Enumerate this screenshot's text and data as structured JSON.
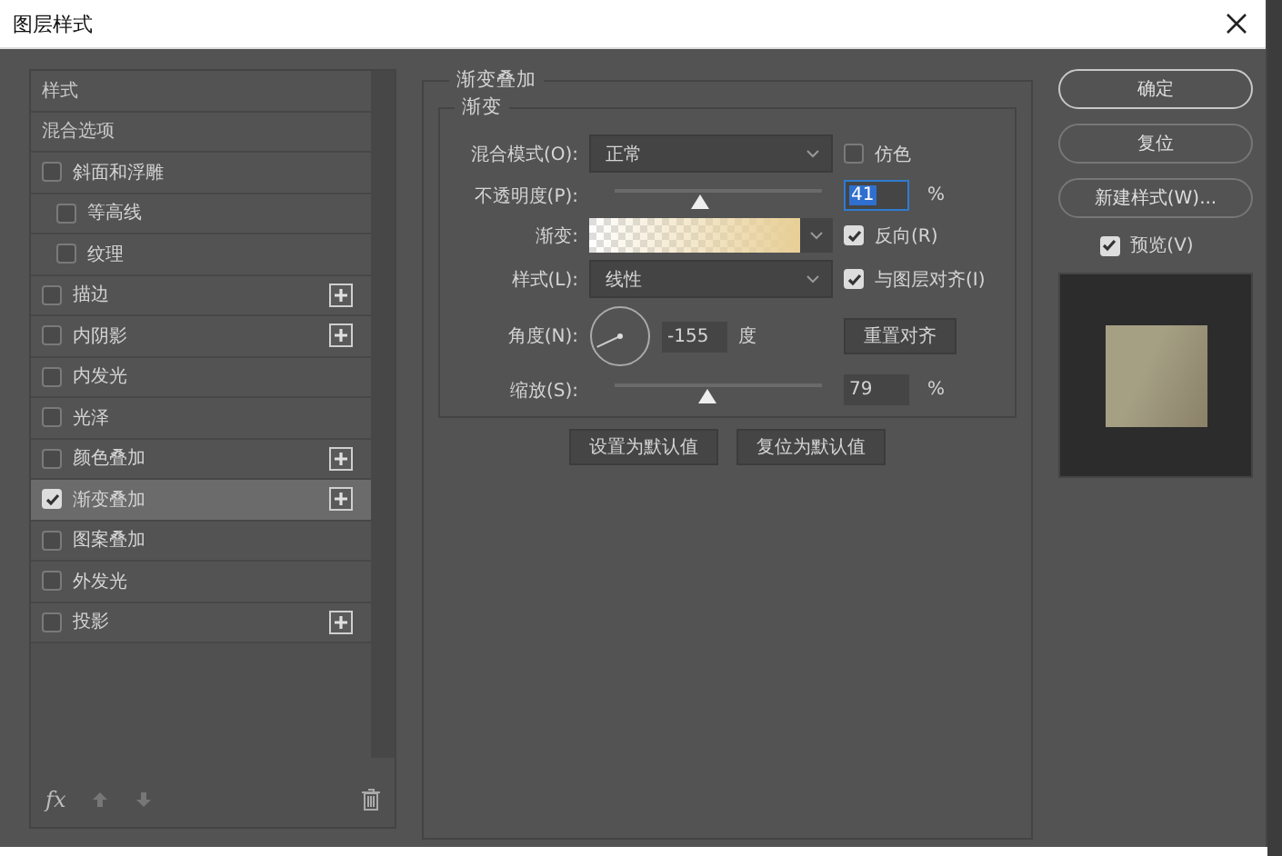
{
  "window": {
    "title": "图层样式"
  },
  "sidebar": {
    "items": [
      {
        "label": "样式",
        "kind": "plain",
        "selected": false
      },
      {
        "label": "混合选项",
        "kind": "plain",
        "selected": false
      },
      {
        "label": "斜面和浮雕",
        "kind": "check",
        "checked": false,
        "selected": false,
        "addable": false,
        "children": [
          {
            "label": "等高线",
            "kind": "check",
            "checked": false,
            "selected": false,
            "addable": false
          },
          {
            "label": "纹理",
            "kind": "check",
            "checked": false,
            "selected": false,
            "addable": false
          }
        ]
      },
      {
        "label": "描边",
        "kind": "check",
        "checked": false,
        "selected": false,
        "addable": true
      },
      {
        "label": "内阴影",
        "kind": "check",
        "checked": false,
        "selected": false,
        "addable": true
      },
      {
        "label": "内发光",
        "kind": "check",
        "checked": false,
        "selected": false,
        "addable": false
      },
      {
        "label": "光泽",
        "kind": "check",
        "checked": false,
        "selected": false,
        "addable": false
      },
      {
        "label": "颜色叠加",
        "kind": "check",
        "checked": false,
        "selected": false,
        "addable": true
      },
      {
        "label": "渐变叠加",
        "kind": "check",
        "checked": true,
        "selected": true,
        "addable": true
      },
      {
        "label": "图案叠加",
        "kind": "check",
        "checked": false,
        "selected": false,
        "addable": false
      },
      {
        "label": "外发光",
        "kind": "check",
        "checked": false,
        "selected": false,
        "addable": false
      },
      {
        "label": "投影",
        "kind": "check",
        "checked": false,
        "selected": false,
        "addable": true
      }
    ],
    "footer": {
      "fx": "fx"
    }
  },
  "panel": {
    "title": "渐变叠加",
    "group": "渐变",
    "blend_mode": {
      "label": "混合模式(O):",
      "value": "正常"
    },
    "dither": {
      "label": "仿色",
      "checked": false
    },
    "opacity": {
      "label": "不透明度(P):",
      "level": 0.41,
      "value": "41",
      "unit": "%"
    },
    "gradient": {
      "label": "渐变:"
    },
    "reverse": {
      "label": "反向(R)",
      "checked": true
    },
    "style": {
      "label": "样式(L):",
      "value": "线性"
    },
    "align": {
      "label": "与图层对齐(I)",
      "checked": true
    },
    "angle": {
      "label": "角度(N):",
      "value": "-155",
      "unit": "度"
    },
    "reset_align": "重置对齐",
    "scale": {
      "label": "缩放(S):",
      "level": 0.45,
      "value": "79",
      "unit": "%"
    },
    "buttons": [
      "设置为默认值",
      "复位为默认值"
    ]
  },
  "actions": {
    "buttons": [
      "确定",
      "复位",
      "新建样式(W)..."
    ],
    "preview": {
      "label": "预览(V)",
      "checked": true
    }
  }
}
